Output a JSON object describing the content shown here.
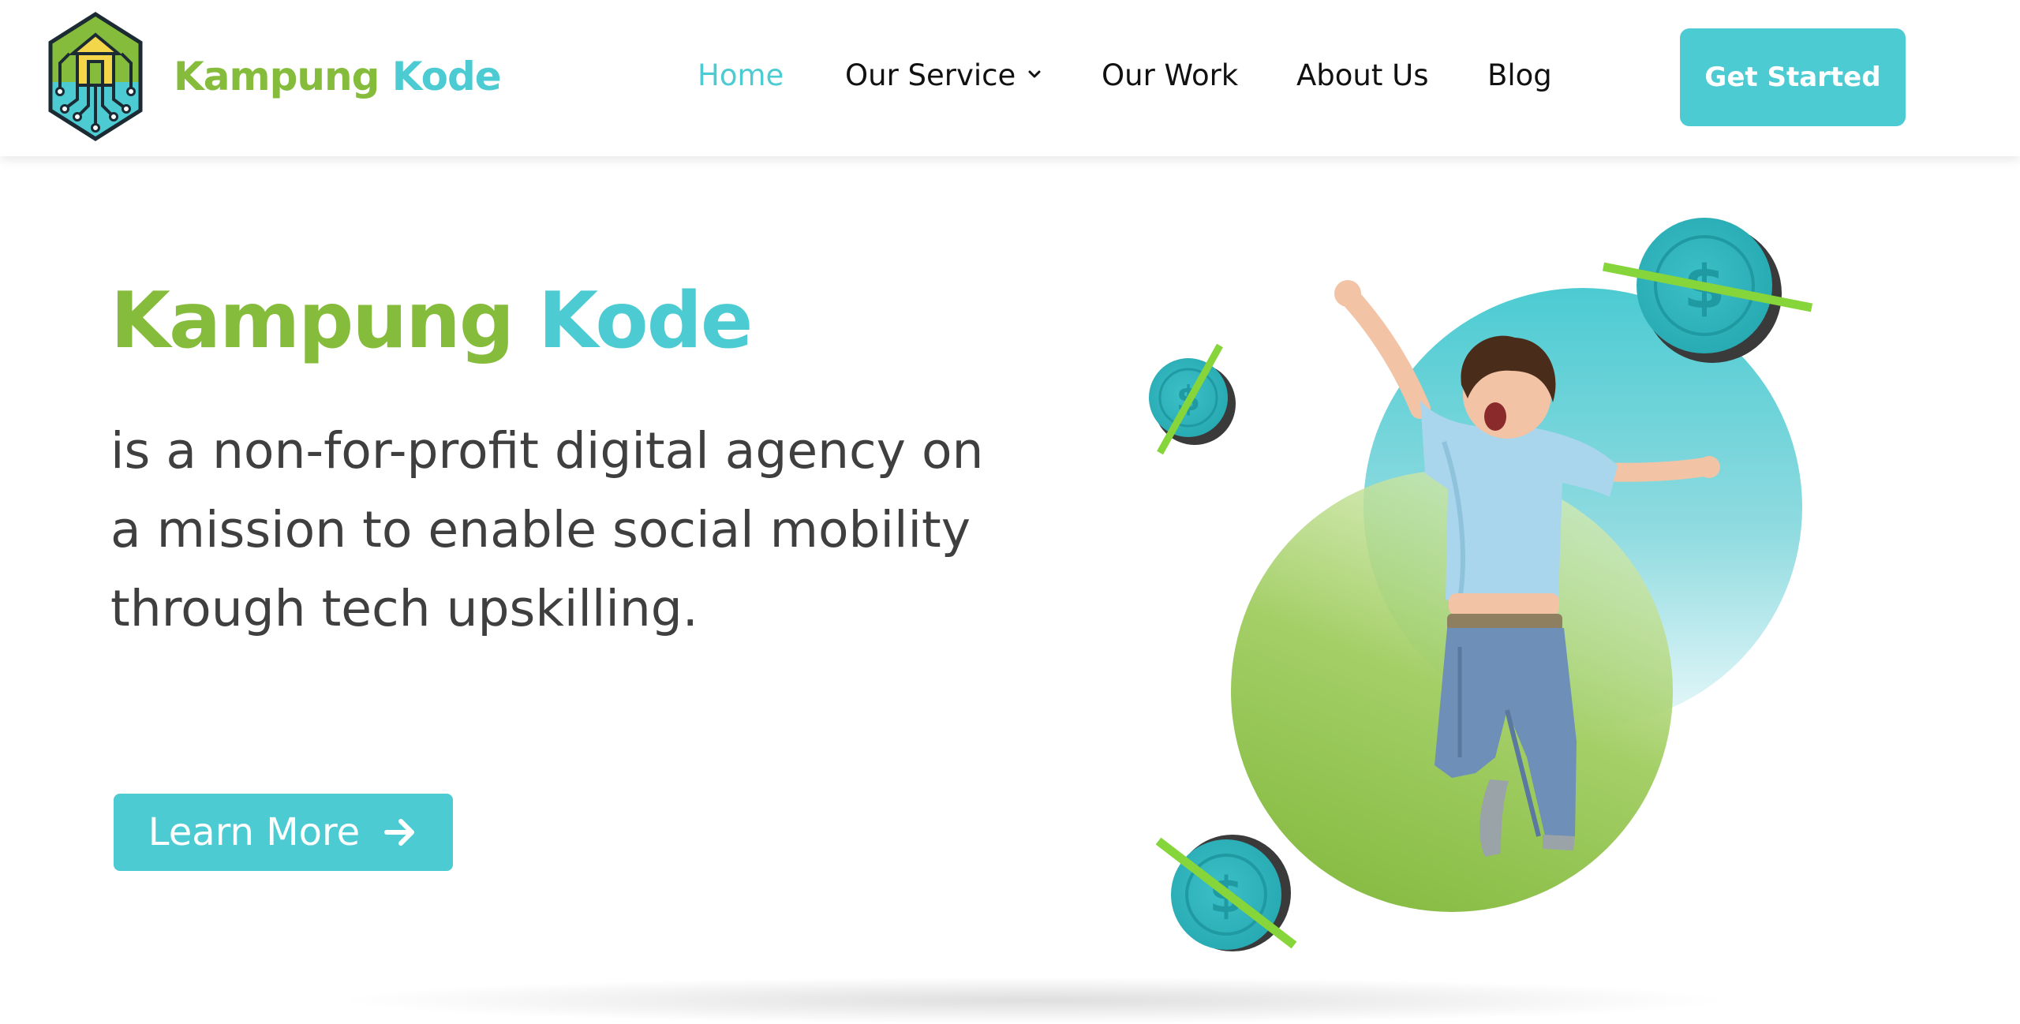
{
  "theme": {
    "green": "#86bc3b",
    "teal": "#4ccbd2",
    "text_dark": "#3f3f3f"
  },
  "header": {
    "logo": {
      "word1": "Kampung",
      "word2": "Kode",
      "icon": "circuit-house-hexagon-icon"
    },
    "nav": [
      {
        "label": "Home",
        "active": true
      },
      {
        "label": "Our Service",
        "has_dropdown": true,
        "dropdown_icon": "chevron-down-icon"
      },
      {
        "label": "Our Work"
      },
      {
        "label": "About Us"
      },
      {
        "label": "Blog"
      }
    ],
    "cta_label": "Get Started"
  },
  "hero": {
    "title_word1": "Kampung",
    "title_word2": "Kode",
    "subtitle": "is a non-for-profit digital agency on a mission to enable social mobility through tech upskilling.",
    "button_label": "Learn More",
    "button_icon": "arrow-right-icon",
    "illustration": {
      "subject": "jumping-child-photo",
      "decor_icons": [
        "teal-circle-shape",
        "green-circle-shape",
        "dollar-coin-icon",
        "dollar-coin-icon",
        "dollar-coin-icon"
      ]
    }
  }
}
